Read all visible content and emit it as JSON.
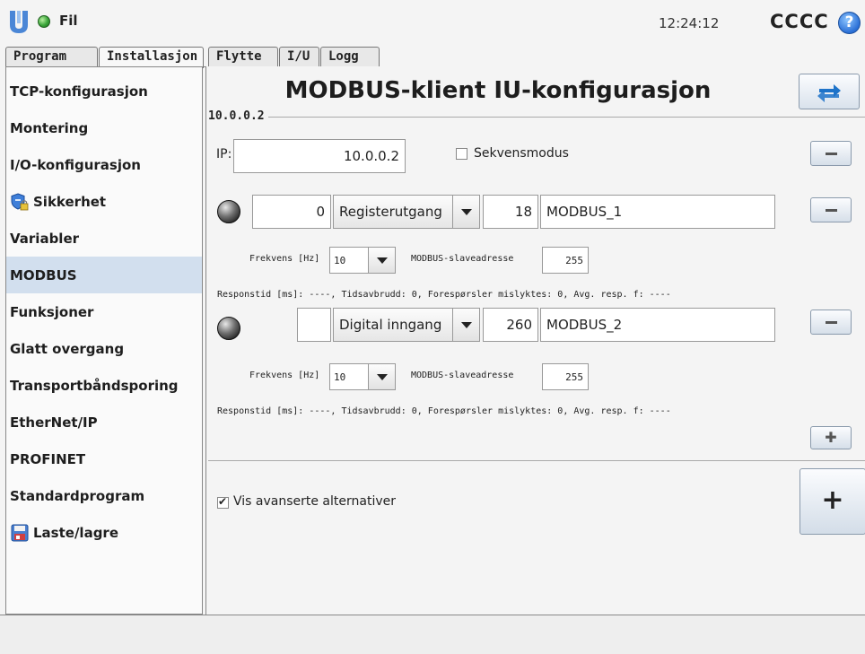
{
  "topbar": {
    "file_label": "Fil",
    "clock": "12:24:12",
    "robot_name": "CCCC",
    "help_glyph": "?"
  },
  "tabs": [
    {
      "label": "Program",
      "active": false
    },
    {
      "label": "Installasjon",
      "active": true
    },
    {
      "label": "Flytte",
      "active": false
    },
    {
      "label": "I/U",
      "active": false
    },
    {
      "label": "Logg",
      "active": false
    }
  ],
  "sidebar": {
    "items": [
      {
        "label": "TCP-konfigurasjon"
      },
      {
        "label": "Montering"
      },
      {
        "label": "I/O-konfigurasjon"
      },
      {
        "label": "Sikkerhet",
        "icon": "shield-lock-icon"
      },
      {
        "label": "Variabler"
      },
      {
        "label": "MODBUS",
        "active": true
      },
      {
        "label": "Funksjoner"
      },
      {
        "label": "Glatt overgang"
      },
      {
        "label": "Transportbåndsporing"
      },
      {
        "label": "EtherNet/IP"
      },
      {
        "label": "PROFINET"
      },
      {
        "label": "Standardprogram"
      },
      {
        "label": "Laste/lagre",
        "icon": "floppy-disk-icon"
      }
    ]
  },
  "main": {
    "title": "MODBUS-klient IU-konfigurasjon",
    "device": {
      "legend": "10.0.0.2",
      "ip_label": "IP:",
      "ip_value": "10.0.0.2",
      "sequence_mode_label": "Sekvensmodus",
      "sequence_mode_checked": false,
      "signals": [
        {
          "value": "0",
          "type": "Registerutgang",
          "address": "18",
          "name": "MODBUS_1",
          "freq_label": "Frekvens [Hz]",
          "freq_value": "10",
          "slave_label": "MODBUS-slaveadresse",
          "slave_value": "255",
          "response": "Responstid [ms]: ----, Tidsavbrudd: 0, Forespørsler mislyktes: 0, Avg. resp. f: ----"
        },
        {
          "value": "",
          "type": "Digital inngang",
          "address": "260",
          "name": "MODBUS_2",
          "freq_label": "Frekvens [Hz]",
          "freq_value": "10",
          "slave_label": "MODBUS-slaveadresse",
          "slave_value": "255",
          "response": "Responstid [ms]: ----, Tidsavbrudd: 0, Forespørsler mislyktes: 0, Avg. resp. f: ----"
        }
      ]
    },
    "advanced_label": "Vis avanserte alternativer",
    "advanced_checked": true,
    "add_small_glyph": "✚",
    "add_big_glyph": "+"
  },
  "colors": {
    "active_sidebar": "#d2dfee",
    "status_green": "#3aa53a",
    "help_blue": "#2a6fd6"
  }
}
